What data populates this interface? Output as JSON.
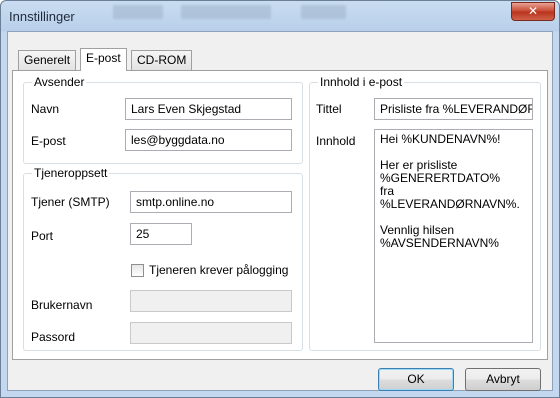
{
  "window": {
    "title": "Innstillinger",
    "close_glyph": "✕"
  },
  "tabs": [
    {
      "label": "Generelt",
      "active": false
    },
    {
      "label": "E-post",
      "active": true
    },
    {
      "label": "CD-ROM",
      "active": false
    }
  ],
  "sender": {
    "group_label": "Avsender",
    "name_label": "Navn",
    "name_value": "Lars Even Skjegstad",
    "email_label": "E-post",
    "email_value": "les@byggdata.no"
  },
  "server": {
    "group_label": "Tjeneroppsett",
    "smtp_label": "Tjener (SMTP)",
    "smtp_value": "smtp.online.no",
    "port_label": "Port",
    "port_value": "25",
    "auth_checkbox_label": "Tjeneren krever pålogging",
    "auth_checked": false,
    "username_label": "Brukernavn",
    "username_value": "",
    "password_label": "Passord",
    "password_value": ""
  },
  "content": {
    "group_label": "Innhold i e-post",
    "subject_label": "Tittel",
    "subject_value": "Prisliste fra %LEVERANDØRNAVN%",
    "body_label": "Innhold",
    "body_value": "Hei %KUNDENAVN%!\n\nHer er prisliste\n%GENERERTDATO%\nfra %LEVERANDØRNAVN%.\n\nVennlig hilsen\n%AVSENDERNAVN%"
  },
  "buttons": {
    "ok": "OK",
    "cancel": "Avbryt"
  }
}
